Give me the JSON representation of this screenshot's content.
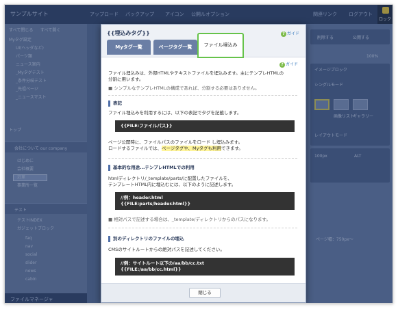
{
  "app": {
    "site_name": "サンプルサイト",
    "topbar_items": [
      "アップロード",
      "バックアップ",
      "アイコン",
      "公開ルオプション"
    ],
    "topbar_right": [
      "関連リンク",
      "ログアウト"
    ],
    "lock_label": "ロック",
    "sidebar": {
      "tools": [
        "すべて閉じる",
        "すべて開く"
      ],
      "section1": "Myタグ設定",
      "items1": [
        "UI(ヘッダなど)",
        "パーツ類",
        "ニュース案内",
        "_Myタグテスト",
        "_条件分岐テスト",
        "_先祖ページ",
        "_ニュースマスト"
      ],
      "top_label": "トップ",
      "section2": "会社について our company",
      "items2": [
        "はじめに",
        "会社概要",
        "沿革",
        "事業所一覧"
      ],
      "section3": "テスト",
      "items3": [
        "テストINDEX",
        "ガジェットブロック"
      ],
      "items4": [
        "faq",
        "nav",
        "social",
        "slider",
        "news",
        "cabin"
      ],
      "footer": "ファイルマネージャ"
    },
    "right_panel": {
      "buttons": [
        "削除する",
        "公開する"
      ],
      "zoom": "100%",
      "image_label": "イメージブロック",
      "single_mode": "シングルモード",
      "icon_labels": [
        "画像リスト",
        "ギャラリー"
      ],
      "alt_label": "ALT",
      "size_value": "100px",
      "retina": "レイアウトモード",
      "bottom_label": "ページ幅：750px〜"
    }
  },
  "modal": {
    "title": "{{埋込みタグ}}",
    "guide_label": "ガイド",
    "tabs": [
      "Myタグ一覧",
      "ページタグ一覧",
      "ファイル埋込み"
    ],
    "intro1": "ファイル埋込みは、外部HTMLやテキストファイルを埋込みます。主にテンプレHTMLの",
    "intro2": "分割に用います。",
    "intro_note": "■ シンプルなテンプレHTMLの構成であれば、分割する必要はありません。",
    "section1_title": "表記",
    "section1_text": "ファイル埋込みを利用するには、以下の表記でタグを記載します。",
    "code1": "{{FILE:ファイルパス}}",
    "section1_text2": "ページ公開時に、ファイルパスのファイルをロード し埋込みます。",
    "section1_text3_pre": "ロードするファイルでは、",
    "section1_text3_hl": "ページタグや、Myタグも利用",
    "section1_text3_post": "できます。",
    "section2_title": "基本的な用途...テンプレHTMLでの利用",
    "section2_text1": "htmlディレクトリ/_template/parts/に配置したファイルを、",
    "section2_text2": "テンプレートHTML内に埋込むには、以下のように記述します。",
    "code2_line1": "//例：header.html",
    "code2_line2": "{{FILE:parts/header.html}}",
    "section2_note": "■ 相対パスで記述する場合は、_template/ディレクトリからのパスになります。",
    "section3_title": "別のディレクトリのファイルの埋込",
    "section3_text": "CMSのサイトルートからの絶対パスを記述してください。",
    "code3_line1": "//例：サイトルート以下の/aa/bb/cc.txt",
    "code3_line2": "{{FILE:/aa/bb/cc.html}}",
    "close_label": "閉じる"
  }
}
